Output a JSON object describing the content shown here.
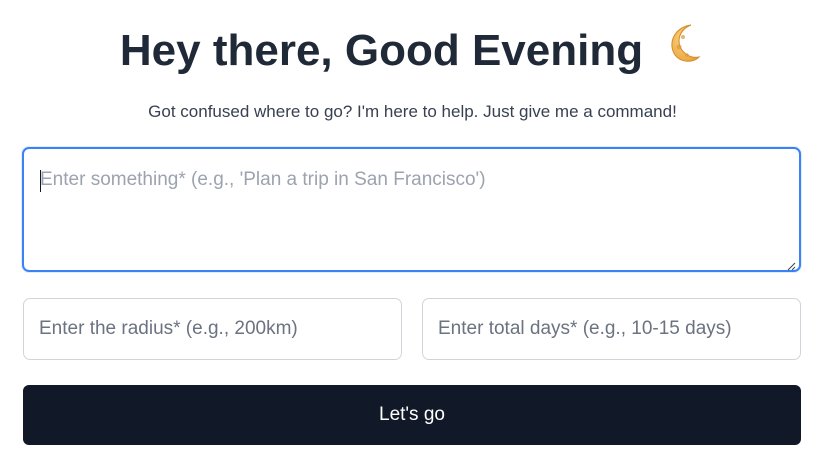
{
  "header": {
    "greeting": "Hey there, Good Evening",
    "greeting_icon": "crescent-moon-icon",
    "subtitle": "Got confused where to go? I'm here to help. Just give me a command!"
  },
  "form": {
    "command": {
      "value": "",
      "placeholder": "Enter something* (e.g., 'Plan a trip in San Francisco')"
    },
    "radius": {
      "value": "",
      "placeholder": "Enter the radius* (e.g., 200km)"
    },
    "days": {
      "value": "",
      "placeholder": "Enter total days* (e.g., 10-15 days)"
    },
    "submit_label": "Let's go"
  },
  "colors": {
    "focus_border": "#3b82f6",
    "button_bg": "#111827",
    "heading": "#1f2937",
    "moon": "#f5b84a"
  }
}
